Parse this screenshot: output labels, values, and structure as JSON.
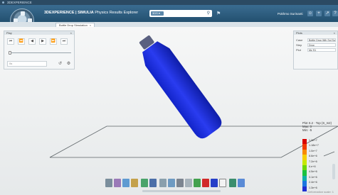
{
  "os_title": "3DEXPERIENCE",
  "app": {
    "brand_bold": "3DEXPERIENCE | SIMULIA",
    "brand_rest": " Physics Results Explorer"
  },
  "search": {
    "tag": "3DS ▾",
    "placeholder": ""
  },
  "user": {
    "name": "Pokhmo Surinanti"
  },
  "tab": {
    "label": "Bottle Drop Simulation",
    "close": "×"
  },
  "play_panel": {
    "title": "Play",
    "buttons": [
      "⏮",
      "⏪",
      "◀",
      "▶",
      "⏩",
      "⏭"
    ],
    "field_placeholder": "0s",
    "ctrls": [
      "↺",
      "⚙"
    ]
  },
  "plot_panel": {
    "title": "Plots",
    "rows": [
      {
        "label": "Case",
        "value": "Bottle Drop Wth Sol Suja 1"
      },
      {
        "label": "Step",
        "value": "Drop"
      },
      {
        "label": "Plot",
        "value": "Mz S1"
      }
    ]
  },
  "legend": {
    "title": "Plot S.2 · Top (S_m2)",
    "lines": [
      "Max: 3",
      "Min: -5"
    ],
    "labels": [
      "1.3e+7",
      "1.18e+7",
      "1.0e+7",
      "8.6e+6",
      "7.2e+6",
      "6.e+6",
      "4.5e+6",
      "3.1e+6",
      "2.4e+6",
      "1.3e+6"
    ],
    "colors": [
      "#d80000",
      "#f03a00",
      "#f88a00",
      "#f6cf00",
      "#c6e800",
      "#6cd800",
      "#19c23f",
      "#0fb0a6",
      "#1a76e0",
      "#1f2fd0"
    ]
  },
  "status": {
    "text": "Deformation scale: 1"
  }
}
